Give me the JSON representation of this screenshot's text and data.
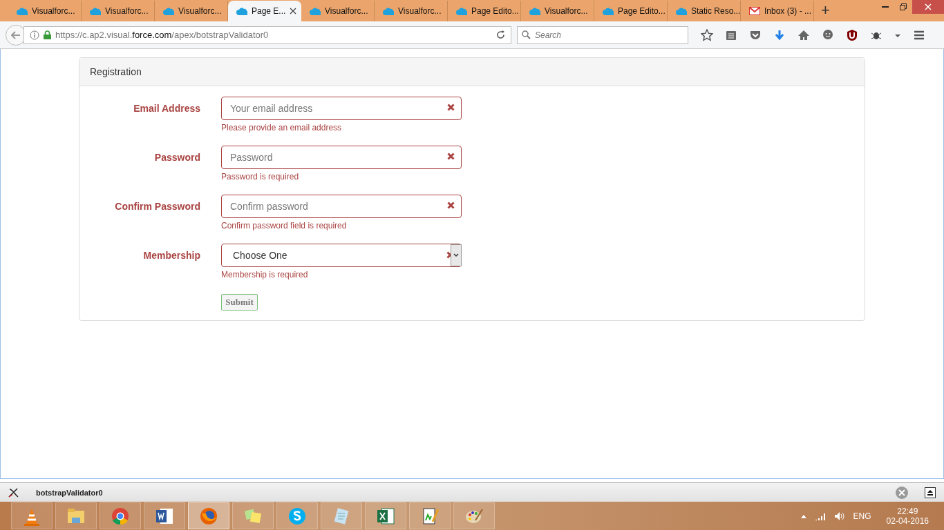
{
  "browser": {
    "tabs": [
      {
        "label": "Visualforc...",
        "kind": "cloud",
        "selected": false
      },
      {
        "label": "Visualforc...",
        "kind": "cloud",
        "selected": false
      },
      {
        "label": "Visualforc...",
        "kind": "cloud",
        "selected": false
      },
      {
        "label": "Page E...",
        "kind": "cloud",
        "selected": true
      },
      {
        "label": "Visualforc...",
        "kind": "cloud",
        "selected": false
      },
      {
        "label": "Visualforc...",
        "kind": "cloud",
        "selected": false
      },
      {
        "label": "Page Edito...",
        "kind": "cloud",
        "selected": false
      },
      {
        "label": "Visualforc...",
        "kind": "cloud",
        "selected": false
      },
      {
        "label": "Page Edito...",
        "kind": "cloud",
        "selected": false
      },
      {
        "label": "Static Reso...",
        "kind": "cloud",
        "selected": false
      },
      {
        "label": "Inbox (3) - ...",
        "kind": "mail",
        "selected": false
      }
    ],
    "new_tab": "+",
    "url": {
      "start": "https://c.ap2.visual.",
      "domain": "force.com",
      "path": "/apex/botstrapValidator0"
    },
    "search": {
      "placeholder": "Search"
    }
  },
  "form": {
    "title": "Registration",
    "fields": [
      {
        "label": "Email Address",
        "kind": "input",
        "placeholder": "Your email address",
        "invalid": true,
        "error": "Please provide an email address"
      },
      {
        "label": "Password",
        "kind": "input",
        "placeholder": "Password",
        "invalid": true,
        "error": "Password is required"
      },
      {
        "label": "Confirm Password",
        "kind": "input",
        "placeholder": "Confirm password",
        "invalid": true,
        "error": "Confirm password field is required"
      },
      {
        "label": "Membership",
        "kind": "select",
        "value": "Choose One",
        "invalid": true,
        "error": "Membership is required"
      }
    ],
    "submit": "Submit"
  },
  "addon_bar": {
    "title": "botstrapValidator0"
  },
  "taskbar": {
    "apps": [
      {
        "kind": "cone",
        "selected": false
      },
      {
        "kind": "folder",
        "selected": false
      },
      {
        "kind": "chrome",
        "selected": false
      },
      {
        "kind": "word",
        "selected": false
      },
      {
        "kind": "firefox",
        "selected": true
      },
      {
        "kind": "notes",
        "selected": false
      },
      {
        "kind": "skype",
        "selected": false
      },
      {
        "kind": "notepad",
        "selected": false
      },
      {
        "kind": "excel",
        "selected": false
      },
      {
        "kind": "editor",
        "selected": false
      },
      {
        "kind": "paint",
        "selected": false
      }
    ],
    "language": "ENG",
    "time": "22:49",
    "date": "02-04-2016"
  }
}
